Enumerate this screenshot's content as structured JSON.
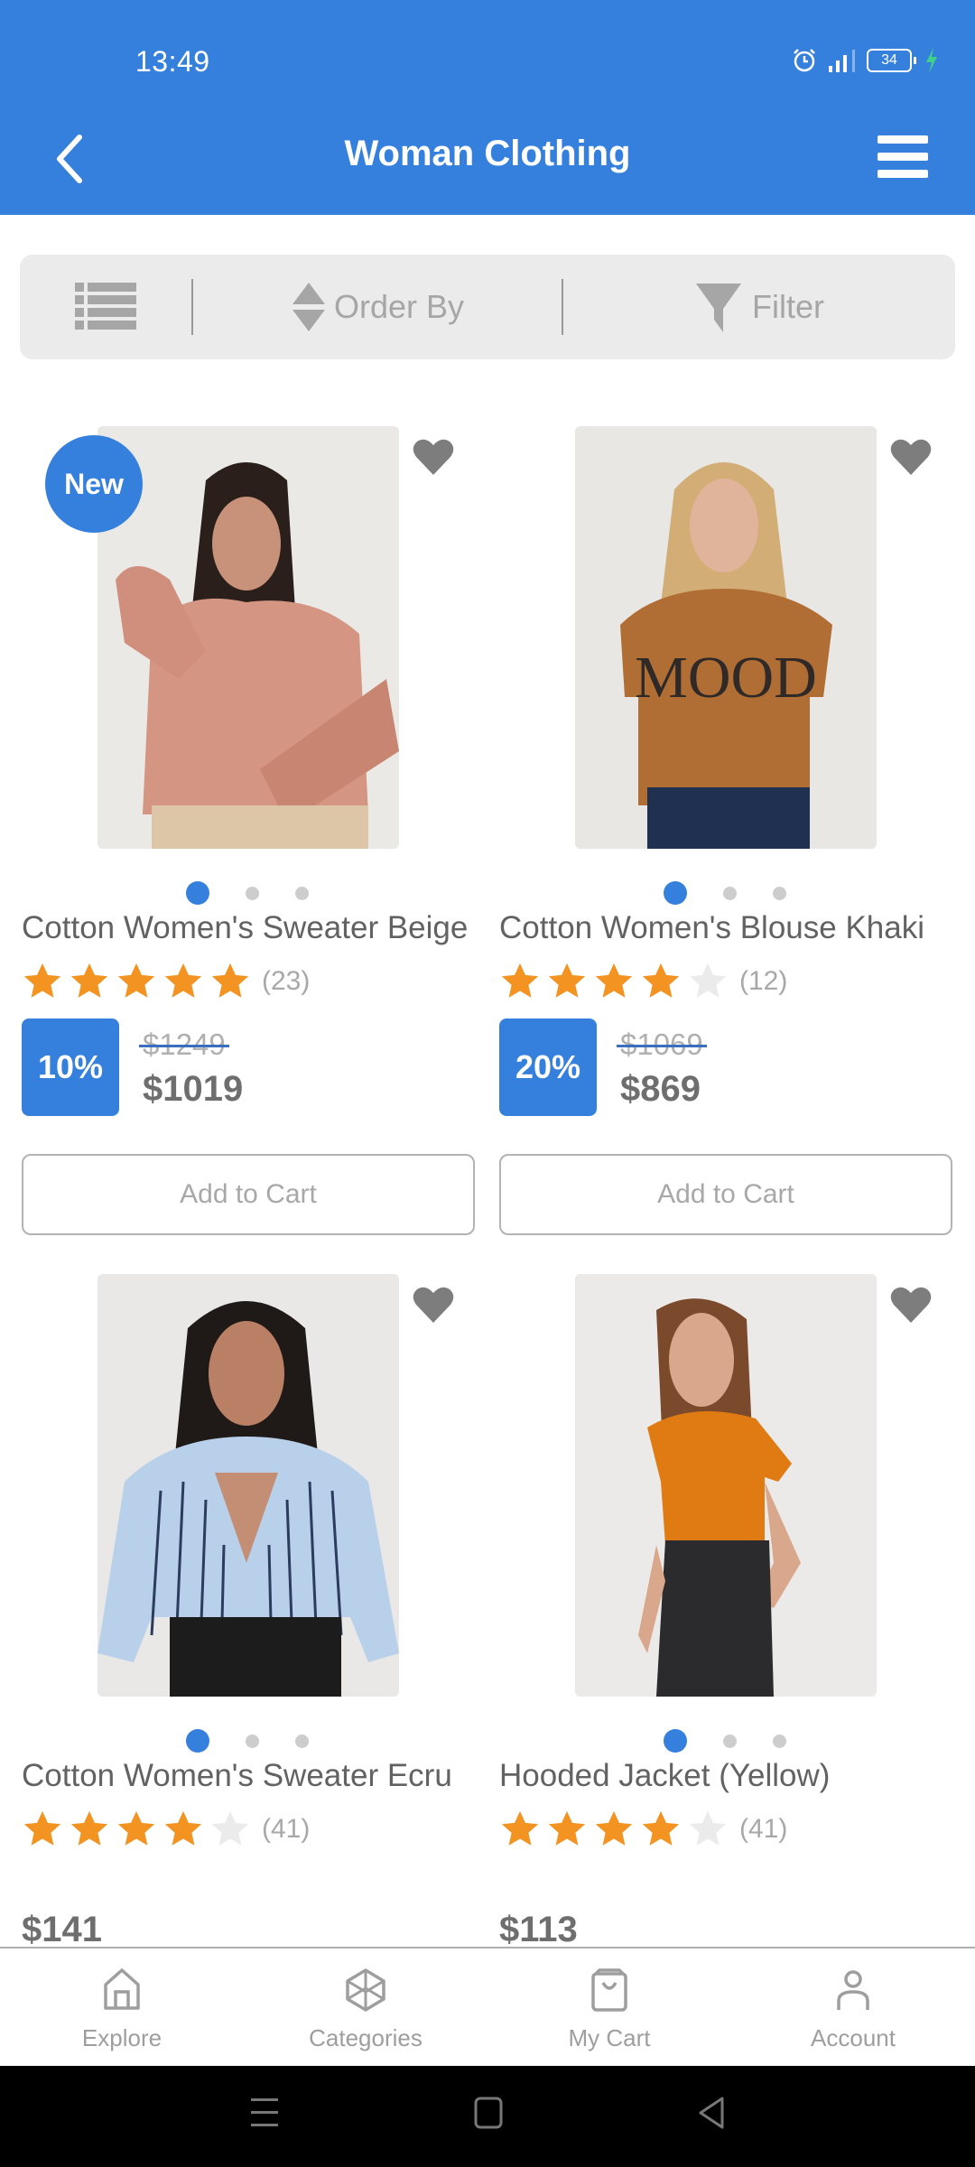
{
  "status_bar": {
    "time": "13:49",
    "battery_level": "34",
    "icons": [
      "alarm-icon",
      "signal-icon",
      "battery-icon",
      "charging-icon"
    ]
  },
  "header": {
    "title": "Woman Clothing",
    "back_icon": "chevron-left-icon",
    "menu_icon": "hamburger-menu-icon"
  },
  "toolbar": {
    "view_toggle_icon": "list-view-icon",
    "order_by_label": "Order By",
    "order_by_icon": "sort-icon",
    "filter_label": "Filter",
    "filter_icon": "funnel-icon"
  },
  "colors": {
    "accent": "#3680dd",
    "star": "#f39322",
    "star_empty": "#ebebeb",
    "text": "#626262"
  },
  "products": [
    {
      "name": "Cotton Women's Sweater Beige",
      "badge": "New",
      "rating": 5,
      "max_rating": 5,
      "review_count": "(23)",
      "discount": "10%",
      "old_price": "$1249",
      "price": "$1019",
      "add_to_cart_label": "Add to Cart",
      "image_count": 3,
      "active_image": 1,
      "image_desc": "woman in pink ruched-sleeve sweater"
    },
    {
      "name": "Cotton Women's Blouse Khaki",
      "badge": null,
      "rating": 4,
      "max_rating": 5,
      "review_count": "(12)",
      "discount": "20%",
      "old_price": "$1069",
      "price": "$869",
      "add_to_cart_label": "Add to Cart",
      "image_count": 3,
      "active_image": 1,
      "image_desc": "woman in brown MOOD t-shirt"
    },
    {
      "name": "Cotton Women's Sweater Ecru",
      "badge": null,
      "rating": 4,
      "max_rating": 5,
      "review_count": "(41)",
      "discount": null,
      "old_price": null,
      "price": "$141",
      "image_count": 3,
      "active_image": 1,
      "image_desc": "woman in blue striped polo sweater"
    },
    {
      "name": "Hooded Jacket (Yellow)",
      "badge": null,
      "rating": 4,
      "max_rating": 5,
      "review_count": "(41)",
      "discount": null,
      "old_price": null,
      "price": "$113",
      "image_count": 3,
      "active_image": 1,
      "image_desc": "woman in orange knit polo shirt"
    }
  ],
  "bottom_nav": [
    {
      "label": "Explore",
      "icon": "home-icon"
    },
    {
      "label": "Categories",
      "icon": "cube-icon"
    },
    {
      "label": "My Cart",
      "icon": "shopping-bag-icon"
    },
    {
      "label": "Account",
      "icon": "user-icon"
    }
  ],
  "system_nav": [
    "recents-icon",
    "home-button-icon",
    "back-triangle-icon"
  ]
}
